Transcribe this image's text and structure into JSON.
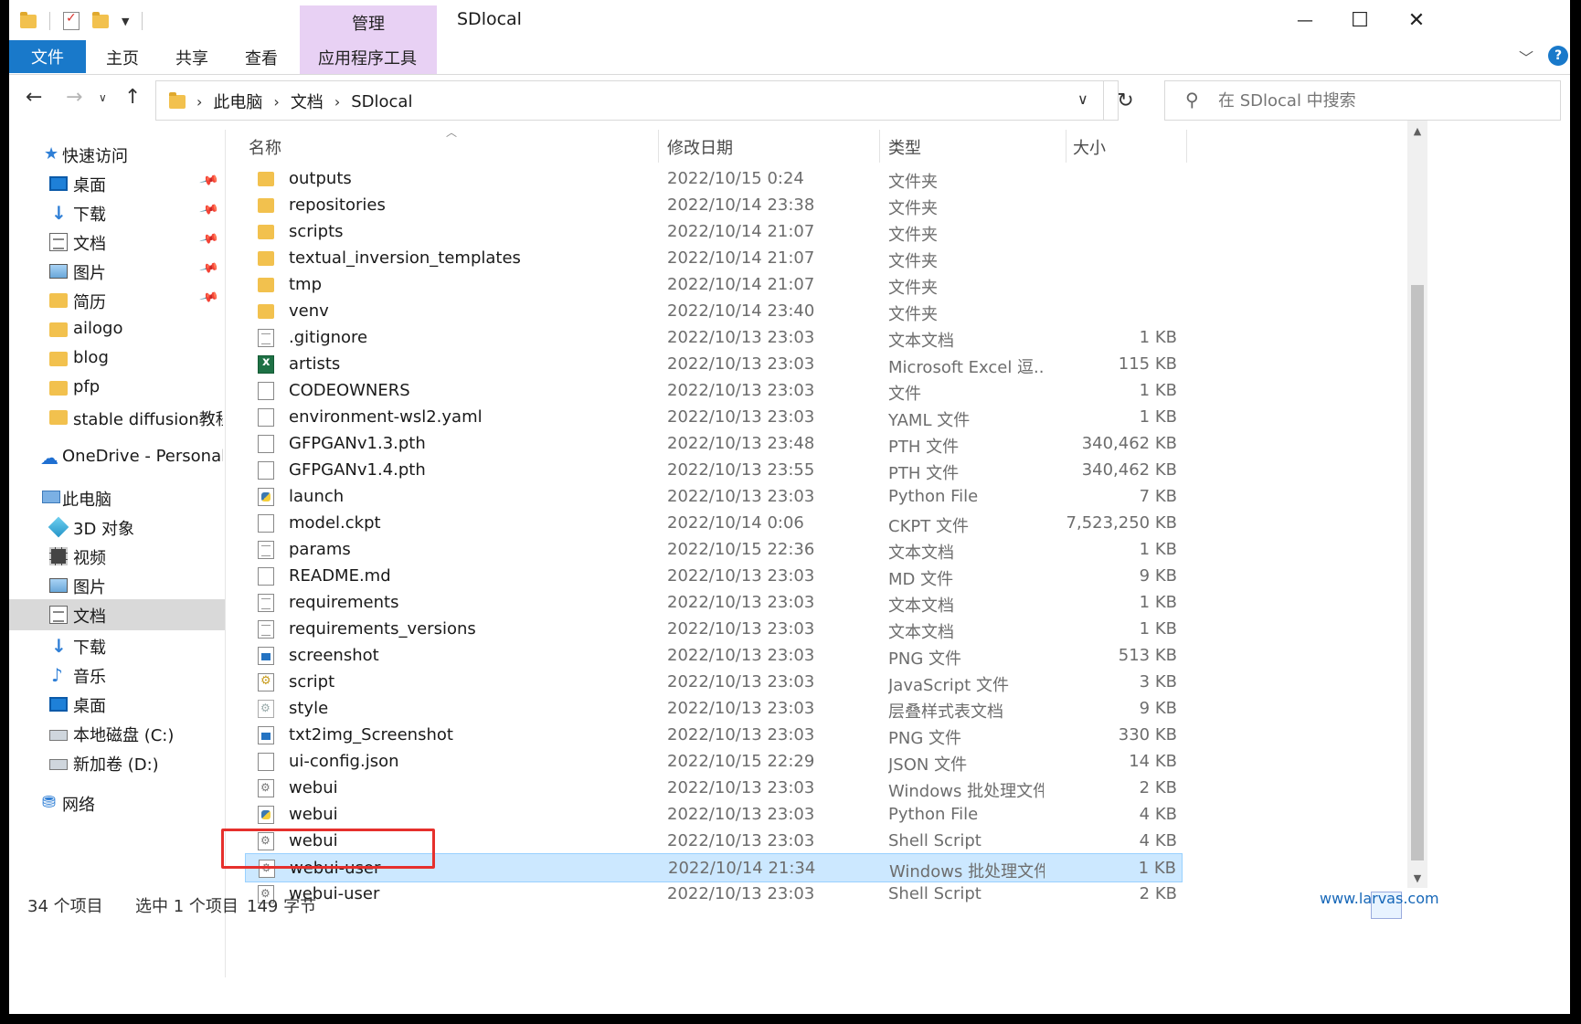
{
  "window": {
    "title": "SDlocal",
    "context_group": "管理",
    "buttons": {
      "minimize": "—",
      "maximize": "☐",
      "close": "✕"
    }
  },
  "ribbon": {
    "tabs": [
      {
        "label": "文件",
        "active": true
      },
      {
        "label": "主页"
      },
      {
        "label": "共享"
      },
      {
        "label": "查看"
      },
      {
        "label": "应用程序工具"
      }
    ],
    "collapse_icon": "﹀",
    "help_icon": "?"
  },
  "address": {
    "crumbs": [
      "此电脑",
      "文档",
      "SDlocal"
    ],
    "separator": "›",
    "refresh": "↻"
  },
  "search": {
    "placeholder": "在 SDlocal 中搜索"
  },
  "nav": {
    "items": [
      {
        "label": "快速访问",
        "icon": "star-icon"
      },
      {
        "label": "桌面",
        "icon": "desktop-icon",
        "pinned": true
      },
      {
        "label": "下载",
        "icon": "download-icon",
        "pinned": true
      },
      {
        "label": "文档",
        "icon": "documents-icon",
        "pinned": true
      },
      {
        "label": "图片",
        "icon": "pictures-icon",
        "pinned": true
      },
      {
        "label": "简历",
        "icon": "folder-icon",
        "pinned": true
      },
      {
        "label": "ailogo",
        "icon": "folder-icon"
      },
      {
        "label": "blog",
        "icon": "folder-icon"
      },
      {
        "label": "pfp",
        "icon": "folder-icon"
      },
      {
        "label": "stable diffusion教程",
        "icon": "folder-icon"
      },
      {
        "label": "OneDrive - Personal",
        "icon": "onedrive-icon"
      },
      {
        "label": "此电脑",
        "icon": "this-pc-icon"
      },
      {
        "label": "3D 对象",
        "icon": "3d-objects-icon"
      },
      {
        "label": "视频",
        "icon": "videos-icon"
      },
      {
        "label": "图片",
        "icon": "pictures-icon"
      },
      {
        "label": "文档",
        "icon": "documents-icon",
        "selected": true
      },
      {
        "label": "下载",
        "icon": "download-icon"
      },
      {
        "label": "音乐",
        "icon": "music-icon"
      },
      {
        "label": "桌面",
        "icon": "desktop-icon"
      },
      {
        "label": "本地磁盘 (C:)",
        "icon": "drive-icon"
      },
      {
        "label": "新加卷 (D:)",
        "icon": "drive-icon"
      },
      {
        "label": "网络",
        "icon": "network-icon"
      }
    ]
  },
  "columns": {
    "name": "名称",
    "date": "修改日期",
    "type": "类型",
    "size": "大小"
  },
  "files": [
    {
      "name": "outputs",
      "date": "2022/10/15 0:24",
      "type": "文件夹",
      "size": "",
      "icon": "folder"
    },
    {
      "name": "repositories",
      "date": "2022/10/14 23:38",
      "type": "文件夹",
      "size": "",
      "icon": "folder"
    },
    {
      "name": "scripts",
      "date": "2022/10/14 21:07",
      "type": "文件夹",
      "size": "",
      "icon": "folder"
    },
    {
      "name": "textual_inversion_templates",
      "date": "2022/10/14 21:07",
      "type": "文件夹",
      "size": "",
      "icon": "folder"
    },
    {
      "name": "tmp",
      "date": "2022/10/14 21:07",
      "type": "文件夹",
      "size": "",
      "icon": "folder"
    },
    {
      "name": "venv",
      "date": "2022/10/14 23:40",
      "type": "文件夹",
      "size": "",
      "icon": "folder"
    },
    {
      "name": ".gitignore",
      "date": "2022/10/13 23:03",
      "type": "文本文档",
      "size": "1 KB",
      "icon": "text"
    },
    {
      "name": "artists",
      "date": "2022/10/13 23:03",
      "type": "Microsoft Excel 逗...",
      "size": "115 KB",
      "icon": "excel"
    },
    {
      "name": "CODEOWNERS",
      "date": "2022/10/13 23:03",
      "type": "文件",
      "size": "1 KB",
      "icon": "blank"
    },
    {
      "name": "environment-wsl2.yaml",
      "date": "2022/10/13 23:03",
      "type": "YAML 文件",
      "size": "1 KB",
      "icon": "blank"
    },
    {
      "name": "GFPGANv1.3.pth",
      "date": "2022/10/13 23:48",
      "type": "PTH 文件",
      "size": "340,462 KB",
      "icon": "blank"
    },
    {
      "name": "GFPGANv1.4.pth",
      "date": "2022/10/13 23:55",
      "type": "PTH 文件",
      "size": "340,462 KB",
      "icon": "blank"
    },
    {
      "name": "launch",
      "date": "2022/10/13 23:03",
      "type": "Python File",
      "size": "7 KB",
      "icon": "py"
    },
    {
      "name": "model.ckpt",
      "date": "2022/10/14 0:06",
      "type": "CKPT 文件",
      "size": "7,523,250 KB",
      "icon": "blank"
    },
    {
      "name": "params",
      "date": "2022/10/15 22:36",
      "type": "文本文档",
      "size": "1 KB",
      "icon": "text"
    },
    {
      "name": "README.md",
      "date": "2022/10/13 23:03",
      "type": "MD 文件",
      "size": "9 KB",
      "icon": "blank"
    },
    {
      "name": "requirements",
      "date": "2022/10/13 23:03",
      "type": "文本文档",
      "size": "1 KB",
      "icon": "text"
    },
    {
      "name": "requirements_versions",
      "date": "2022/10/13 23:03",
      "type": "文本文档",
      "size": "1 KB",
      "icon": "text"
    },
    {
      "name": "screenshot",
      "date": "2022/10/13 23:03",
      "type": "PNG 文件",
      "size": "513 KB",
      "icon": "png"
    },
    {
      "name": "script",
      "date": "2022/10/13 23:03",
      "type": "JavaScript 文件",
      "size": "3 KB",
      "icon": "js"
    },
    {
      "name": "style",
      "date": "2022/10/13 23:03",
      "type": "层叠样式表文档",
      "size": "9 KB",
      "icon": "css"
    },
    {
      "name": "txt2img_Screenshot",
      "date": "2022/10/13 23:03",
      "type": "PNG 文件",
      "size": "330 KB",
      "icon": "png"
    },
    {
      "name": "ui-config.json",
      "date": "2022/10/15 22:29",
      "type": "JSON 文件",
      "size": "14 KB",
      "icon": "blank"
    },
    {
      "name": "webui",
      "date": "2022/10/13 23:03",
      "type": "Windows 批处理文件",
      "size": "2 KB",
      "icon": "bat"
    },
    {
      "name": "webui",
      "date": "2022/10/13 23:03",
      "type": "Python File",
      "size": "4 KB",
      "icon": "py"
    },
    {
      "name": "webui",
      "date": "2022/10/13 23:03",
      "type": "Shell Script",
      "size": "4 KB",
      "icon": "bat"
    },
    {
      "name": "webui-user",
      "date": "2022/10/14 21:34",
      "type": "Windows 批处理文件",
      "size": "1 KB",
      "icon": "bat",
      "selected": true
    },
    {
      "name": "webui-user",
      "date": "2022/10/13 23:03",
      "type": "Shell Script",
      "size": "2 KB",
      "icon": "bat"
    }
  ],
  "status": {
    "count": "34 个项目",
    "selection": "选中 1 个项目",
    "bytes": "149 字节"
  },
  "watermark": "www.larvas.com",
  "colors": {
    "accent": "#1979ca",
    "manage_tab": "#e8d1f4",
    "selection": "#cce8ff",
    "highlight": "#e6302c"
  }
}
